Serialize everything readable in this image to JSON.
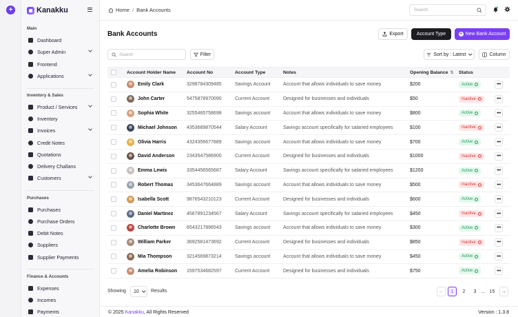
{
  "app": {
    "brand": "Kanakku"
  },
  "breadcrumb": {
    "home": "Home",
    "separator": "/",
    "current": "Bank Accounts"
  },
  "topbar": {
    "search_placeholder": "Search"
  },
  "sidebar": {
    "sections": [
      {
        "title": "Main",
        "items": [
          {
            "label": "Dashboard",
            "icon": "dashboard-icon",
            "chevron": false
          },
          {
            "label": "Super Admin",
            "icon": "user-shield-icon",
            "chevron": true
          },
          {
            "label": "Frontend",
            "icon": "globe-icon",
            "chevron": false
          },
          {
            "label": "Applications",
            "icon": "apps-icon",
            "chevron": true
          }
        ]
      },
      {
        "title": "Inventory & Sales",
        "items": [
          {
            "label": "Product / Services",
            "icon": "box-icon",
            "chevron": true
          },
          {
            "label": "Inventory",
            "icon": "inventory-icon",
            "chevron": false
          },
          {
            "label": "Invoices",
            "icon": "invoice-icon",
            "chevron": true
          },
          {
            "label": "Credit Notes",
            "icon": "credit-note-icon",
            "chevron": false
          },
          {
            "label": "Quotations",
            "icon": "quotation-icon",
            "chevron": false
          },
          {
            "label": "Delivery Challans",
            "icon": "truck-icon",
            "chevron": false
          },
          {
            "label": "Customers",
            "icon": "customers-icon",
            "chevron": true
          }
        ]
      },
      {
        "title": "Purchases",
        "items": [
          {
            "label": "Purchases",
            "icon": "purchase-icon",
            "chevron": false
          },
          {
            "label": "Purchase Orders",
            "icon": "order-icon",
            "chevron": false
          },
          {
            "label": "Debit Notes",
            "icon": "debit-note-icon",
            "chevron": false
          },
          {
            "label": "Suppliers",
            "icon": "supplier-icon",
            "chevron": false
          },
          {
            "label": "Supplier Payments",
            "icon": "payment-icon",
            "chevron": false
          }
        ]
      },
      {
        "title": "Finance & Accounts",
        "items": [
          {
            "label": "Expenses",
            "icon": "expense-icon",
            "chevron": false
          },
          {
            "label": "Incomes",
            "icon": "income-icon",
            "chevron": false
          },
          {
            "label": "Payments",
            "icon": "payments-icon",
            "chevron": false
          }
        ]
      }
    ]
  },
  "page": {
    "title": "Bank Accounts",
    "export_label": "Export",
    "account_type_label": "Account Type",
    "new_label": "New Bank Account",
    "search_placeholder": "Search",
    "filter_label": "Filter",
    "sort_label": "Sort by : Latest",
    "column_label": "Column"
  },
  "table": {
    "columns": [
      "Account Holder Name",
      "Account No",
      "Account Type",
      "Notes",
      "Opening Balance",
      "Status"
    ],
    "rows": [
      {
        "name": "Emily Clark",
        "account_no": "3298784309485",
        "type": "Savings Account",
        "notes": "Account that allows individuals to save money",
        "balance": "$200",
        "status": "Active",
        "avatar": "#c98e6d"
      },
      {
        "name": "John Carter",
        "account_no": "5475878970090",
        "type": "Current Account",
        "notes": "Designed for businesses and individuals",
        "balance": "$50",
        "status": "Inactive",
        "avatar": "#7d6a5c"
      },
      {
        "name": "Sophia White",
        "account_no": "3255465758698",
        "type": "Savings account",
        "notes": "Account that allows individuals to save money",
        "balance": "$800",
        "status": "Active",
        "avatar": "#d9a07c"
      },
      {
        "name": "Michael Johnson",
        "account_no": "4353689870544",
        "type": "Salary Account",
        "notes": "Savings account specifically for salaried employees",
        "balance": "$100",
        "status": "Inactive",
        "avatar": "#3d4458"
      },
      {
        "name": "Olivia Harris",
        "account_no": "4324356677889",
        "type": "Savings account",
        "notes": "Account that allows individuals to save money",
        "balance": "$700",
        "status": "Active",
        "avatar": "#e8b04a"
      },
      {
        "name": "David Anderson",
        "account_no": "2343547586900",
        "type": "Current Account",
        "notes": "Designed for businesses and individuals",
        "balance": "$1000",
        "status": "Inactive",
        "avatar": "#6b5447"
      },
      {
        "name": "Emma Lewis",
        "account_no": "3354456565687",
        "type": "Salary Account",
        "notes": "Savings account specifically for salaried employees",
        "balance": "$1200",
        "status": "Active",
        "avatar": "#c7c2bb"
      },
      {
        "name": "Robert Thomas",
        "account_no": "3453647664889",
        "type": "Savings account",
        "notes": "Account that allows individuals to save money",
        "balance": "$500",
        "status": "Inactive",
        "avatar": "#9aa1ab"
      },
      {
        "name": "Isabella Scott",
        "account_no": "9876543210123",
        "type": "Current Account",
        "notes": "Designed for businesses and individuals",
        "balance": "$600",
        "status": "Active",
        "avatar": "#d39a57"
      },
      {
        "name": "Daniel Martinez",
        "account_no": "4567891234567",
        "type": "Salary Account",
        "notes": "Savings account specifically for salaried employees",
        "balance": "$450",
        "status": "Inactive",
        "avatar": "#5b6b82"
      },
      {
        "name": "Charlotte Brown",
        "account_no": "6543217896543",
        "type": "Savings account",
        "notes": "Account that allows individuals to save money",
        "balance": "$300",
        "status": "Active",
        "avatar": "#b5473f"
      },
      {
        "name": "William Parker",
        "account_no": "3692581473692",
        "type": "Current Account",
        "notes": "Designed for businesses and individuals",
        "balance": "$850",
        "status": "Inactive",
        "avatar": "#a58a78"
      },
      {
        "name": "Mia Thompson",
        "account_no": "3214569873214",
        "type": "Savings account",
        "notes": "Account that allows individuals to save money",
        "balance": "$450",
        "status": "Active",
        "avatar": "#8c6a58"
      },
      {
        "name": "Amelia Robinson",
        "account_no": "1597534682597",
        "type": "Current Account",
        "notes": "Designed for businesses and individuals",
        "balance": "$750",
        "status": "Active",
        "avatar": "#c48e72"
      }
    ]
  },
  "pagination": {
    "showing_label": "Showing",
    "per_page": "10",
    "results_label": "Results",
    "pages": [
      "1",
      "2",
      "3",
      "...",
      "15"
    ],
    "active_page": "1"
  },
  "footer": {
    "copyright_prefix": "© 2025",
    "brand": "Kanakku",
    "copyright_suffix": ", All Rights Reserved",
    "version": "Version : 1.3.8"
  },
  "colors": {
    "accent": "#7a3ff2",
    "active": "#1f9b55",
    "inactive": "#e03131",
    "dark_button": "#1c1c22"
  }
}
